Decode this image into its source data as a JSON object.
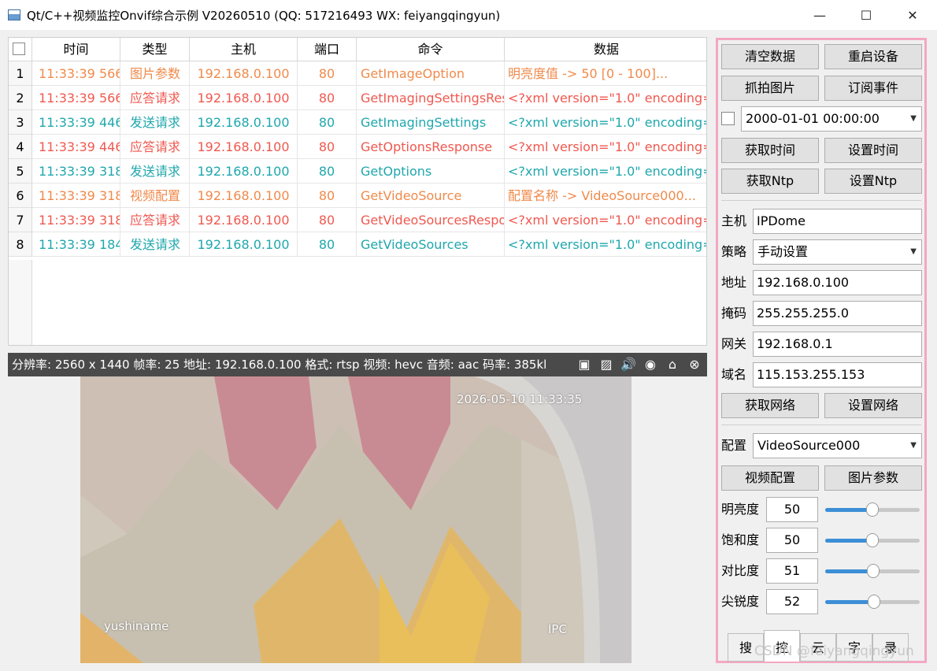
{
  "window": {
    "title": "Qt/C++视频监控Onvif综合示例 V20260510 (QQ: 517216493 WX: feiyangqingyun)",
    "minimize_icon": "minimize-icon",
    "maximize_icon": "maximize-icon",
    "close_icon": "close-icon"
  },
  "table": {
    "headers": [
      "时间",
      "类型",
      "主机",
      "端口",
      "命令",
      "数据"
    ],
    "rows": [
      {
        "num": "1",
        "time": "11:33:39 566",
        "type": "图片参数",
        "host": "192.168.0.100",
        "port": "80",
        "cmd": "GetImageOption",
        "data": "明亮度值 -> 50 [0 - 100]...",
        "color": "#f08a4b"
      },
      {
        "num": "2",
        "time": "11:33:39 566",
        "type": "应答请求",
        "host": "192.168.0.100",
        "port": "80",
        "cmd": "GetImagingSettingsRes",
        "data": "<?xml version=\"1.0\" encoding=\"",
        "color": "#f0584f"
      },
      {
        "num": "3",
        "time": "11:33:39 446",
        "type": "发送请求",
        "host": "192.168.0.100",
        "port": "80",
        "cmd": "GetImagingSettings",
        "data": "<?xml version=\"1.0\" encoding=\"",
        "color": "#1fa7ad"
      },
      {
        "num": "4",
        "time": "11:33:39 446",
        "type": "应答请求",
        "host": "192.168.0.100",
        "port": "80",
        "cmd": "GetOptionsResponse",
        "data": "<?xml version=\"1.0\" encoding=\"",
        "color": "#f0584f"
      },
      {
        "num": "5",
        "time": "11:33:39 318",
        "type": "发送请求",
        "host": "192.168.0.100",
        "port": "80",
        "cmd": "GetOptions",
        "data": "<?xml version=\"1.0\" encoding=\"",
        "color": "#1fa7ad"
      },
      {
        "num": "6",
        "time": "11:33:39 318",
        "type": "视频配置",
        "host": "192.168.0.100",
        "port": "80",
        "cmd": "GetVideoSource",
        "data": "配置名称 -> VideoSource000...",
        "color": "#f08a4b"
      },
      {
        "num": "7",
        "time": "11:33:39 318",
        "type": "应答请求",
        "host": "192.168.0.100",
        "port": "80",
        "cmd": "GetVideoSourcesRespo",
        "data": "<?xml version=\"1.0\" encoding=\"",
        "color": "#f0584f"
      },
      {
        "num": "8",
        "time": "11:33:39 184",
        "type": "发送请求",
        "host": "192.168.0.100",
        "port": "80",
        "cmd": "GetVideoSources",
        "data": "<?xml version=\"1.0\" encoding=\"",
        "color": "#1fa7ad"
      }
    ]
  },
  "video": {
    "info": "分辨率: 2560 x 1440  帧率: 25  地址: 192.168.0.100  格式: rtsp  视频: hevc  音频: aac  码率: 385kl",
    "osd_time": "2026-05-10 11:33:35",
    "osd_name": "yushiname",
    "osd_ipc": "IPC",
    "icons": [
      "record-icon",
      "snapshot-icon",
      "volume-icon",
      "target-icon",
      "alarm-icon",
      "close-circle-icon"
    ]
  },
  "panel": {
    "btn_clear": "清空数据",
    "btn_reboot": "重启设备",
    "btn_snap": "抓拍图片",
    "btn_subscribe": "订阅事件",
    "datetime": "2000-01-01 00:00:00",
    "btn_get_time": "获取时间",
    "btn_set_time": "设置时间",
    "btn_get_ntp": "获取Ntp",
    "btn_set_ntp": "设置Ntp",
    "lbl_host": "主机",
    "host": "IPDome",
    "lbl_policy": "策略",
    "policy": "手动设置",
    "lbl_addr": "地址",
    "addr": "192.168.0.100",
    "lbl_mask": "掩码",
    "mask": "255.255.255.0",
    "lbl_gateway": "网关",
    "gateway": "192.168.0.1",
    "lbl_dns": "域名",
    "dns": "115.153.255.153",
    "btn_get_net": "获取网络",
    "btn_set_net": "设置网络",
    "lbl_config": "配置",
    "config": "VideoSource000",
    "btn_video_cfg": "视频配置",
    "btn_image_param": "图片参数",
    "sliders": [
      {
        "label": "明亮度",
        "value": "50",
        "fraction": 0.5
      },
      {
        "label": "饱和度",
        "value": "50",
        "fraction": 0.5
      },
      {
        "label": "对比度",
        "value": "51",
        "fraction": 0.51
      },
      {
        "label": "尖锐度",
        "value": "52",
        "fraction": 0.52
      }
    ],
    "tabs": [
      "搜",
      "控",
      "云",
      "字",
      "录"
    ],
    "active_tab": 1
  },
  "watermark": "CSDN @feiyangqingyun"
}
